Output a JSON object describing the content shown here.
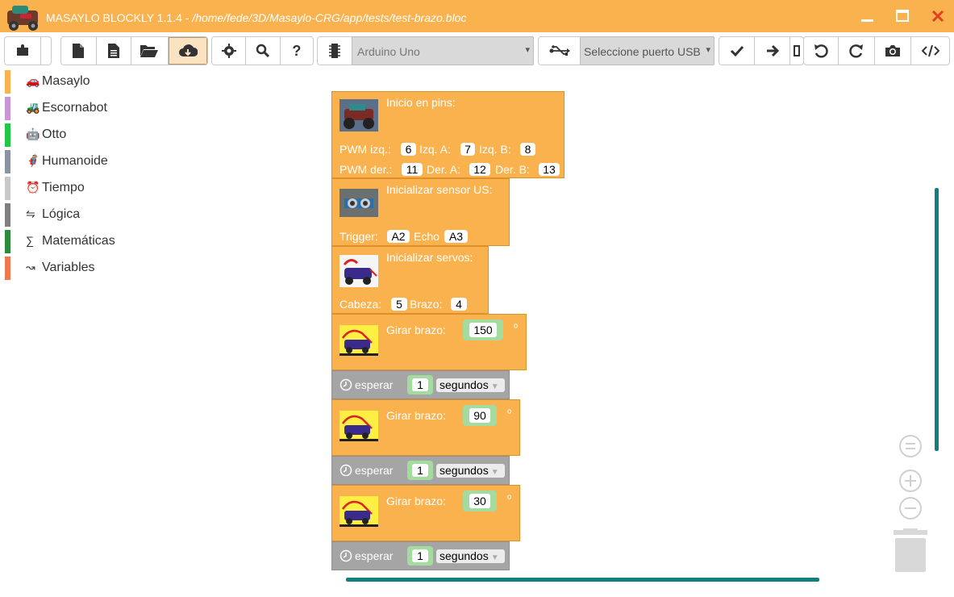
{
  "window": {
    "title_app": "MASAYLO BLOCKLY 1.1.4 - ",
    "title_path": "/home/fede/3D/Masaylo-CRG/app/tests/test-brazo.bloc",
    "minimize": "—",
    "maximize": "□",
    "close": "✕"
  },
  "toolbar": {
    "board_select": "Arduino Uno",
    "usb_select": "Seleccione puerto USB"
  },
  "sidebar": {
    "categories": [
      {
        "label": "Masaylo",
        "icon": "🚗",
        "color": "#fab24f"
      },
      {
        "label": "Escornabot",
        "icon": "🚜",
        "color": "#c896d7"
      },
      {
        "label": "Otto",
        "icon": "🤖",
        "color": "#22c845"
      },
      {
        "label": "Humanoide",
        "icon": "🦸",
        "color": "#8a949e"
      },
      {
        "label": "Tiempo",
        "icon": "⏰",
        "color": "#c8c8c8"
      },
      {
        "label": "Lógica",
        "icon": "⇋",
        "color": "#7f7f7f"
      },
      {
        "label": "Matemáticas",
        "icon": "∑",
        "color": "#2e8b3e"
      },
      {
        "label": "Variables",
        "icon": "↝",
        "color": "#f07850"
      }
    ]
  },
  "blocks": {
    "init_pins": {
      "title": "Inicio en pins:",
      "pwm_left_label": "PWM izq.:",
      "pwm_left": "6",
      "left_a_label": "Izq. A:",
      "left_a": "7",
      "left_b_label": "Izq. B:",
      "left_b": "8",
      "pwm_right_label": "PWM der.:",
      "pwm_right": "11",
      "right_a_label": "Der. A:",
      "right_a": "12",
      "right_b_label": "Der. B:",
      "right_b": "13"
    },
    "init_us": {
      "title": "Inicializar sensor US:",
      "trigger_label": "Trigger:",
      "trigger": "A2",
      "echo_label": "Echo",
      "echo": "A3"
    },
    "init_servos": {
      "title": "Inicializar servos:",
      "head_label": "Cabeza:",
      "head": "5",
      "arm_label": "Brazo:",
      "arm": "4"
    },
    "arm_label": "Girar brazo:",
    "degree": "º",
    "arm_values": [
      "150",
      "90",
      "30"
    ],
    "wait_label": "esperar",
    "wait_value": "1",
    "wait_unit": "segundos"
  }
}
